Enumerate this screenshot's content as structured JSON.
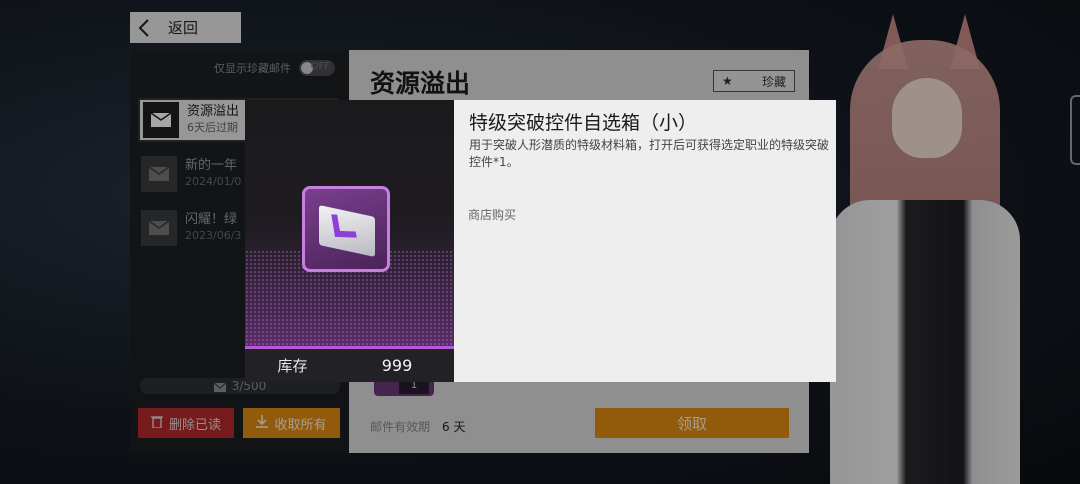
{
  "back_button": {
    "label": "返回"
  },
  "mail_list": {
    "filter_label": "仅显示珍藏邮件",
    "filter_state": "OFF",
    "items": [
      {
        "title": "资源溢出",
        "subtitle": "6天后过期",
        "selected": true
      },
      {
        "title": "新的一年",
        "subtitle": "2024/01/0",
        "selected": false
      },
      {
        "title": "闪耀！绿",
        "subtitle": "2023/06/3",
        "selected": false
      }
    ],
    "count": "3/500",
    "delete_read_label": "删除已读",
    "collect_all_label": "收取所有"
  },
  "mail_detail": {
    "title": "资源溢出",
    "favorite_label": "珍藏",
    "attachment_qty": "1",
    "expiry_label": "邮件有效期",
    "expiry_value": "6 天",
    "claim_label": "领取"
  },
  "item_popup": {
    "name": "特级突破控件自选箱（小）",
    "description": "用于突破人形潜质的特级材料箱，打开后可获得选定职业的特级突破控件*1。",
    "source": "商店购买",
    "stock_label": "库存",
    "stock_value": "999",
    "rarity_color": "#b45ad8"
  },
  "colors": {
    "accent_orange": "#e08a12",
    "danger_red": "#b52a2a"
  }
}
